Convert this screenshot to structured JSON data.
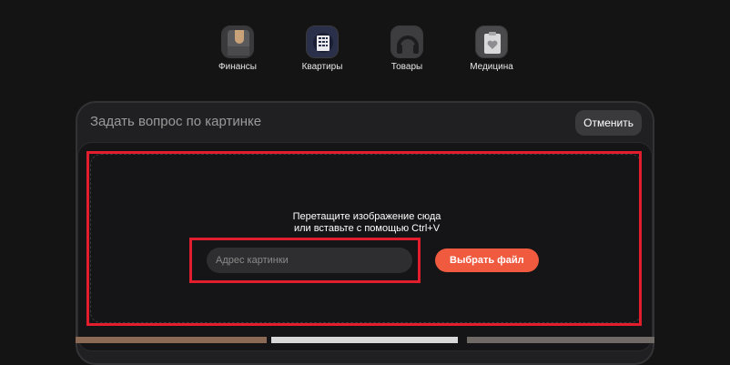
{
  "categories": [
    {
      "label": "Финансы",
      "icon": "wallet-icon"
    },
    {
      "label": "Квартиры",
      "icon": "building-icon"
    },
    {
      "label": "Товары",
      "icon": "headphones-icon"
    },
    {
      "label": "Медицина",
      "icon": "medical-icon"
    }
  ],
  "search": {
    "query_placeholder": "Задать вопрос по картинке",
    "cancel_label": "Отменить"
  },
  "upload": {
    "hint_line1": "Перетащите изображение сюда",
    "hint_line2": "или вставьте с помощью Ctrl+V",
    "url_placeholder": "Адрес картинки",
    "choose_file_label": "Выбрать файл"
  },
  "colors": {
    "background": "#141414",
    "accent": "#f05a3f",
    "highlight_frame": "#e11d2e"
  }
}
